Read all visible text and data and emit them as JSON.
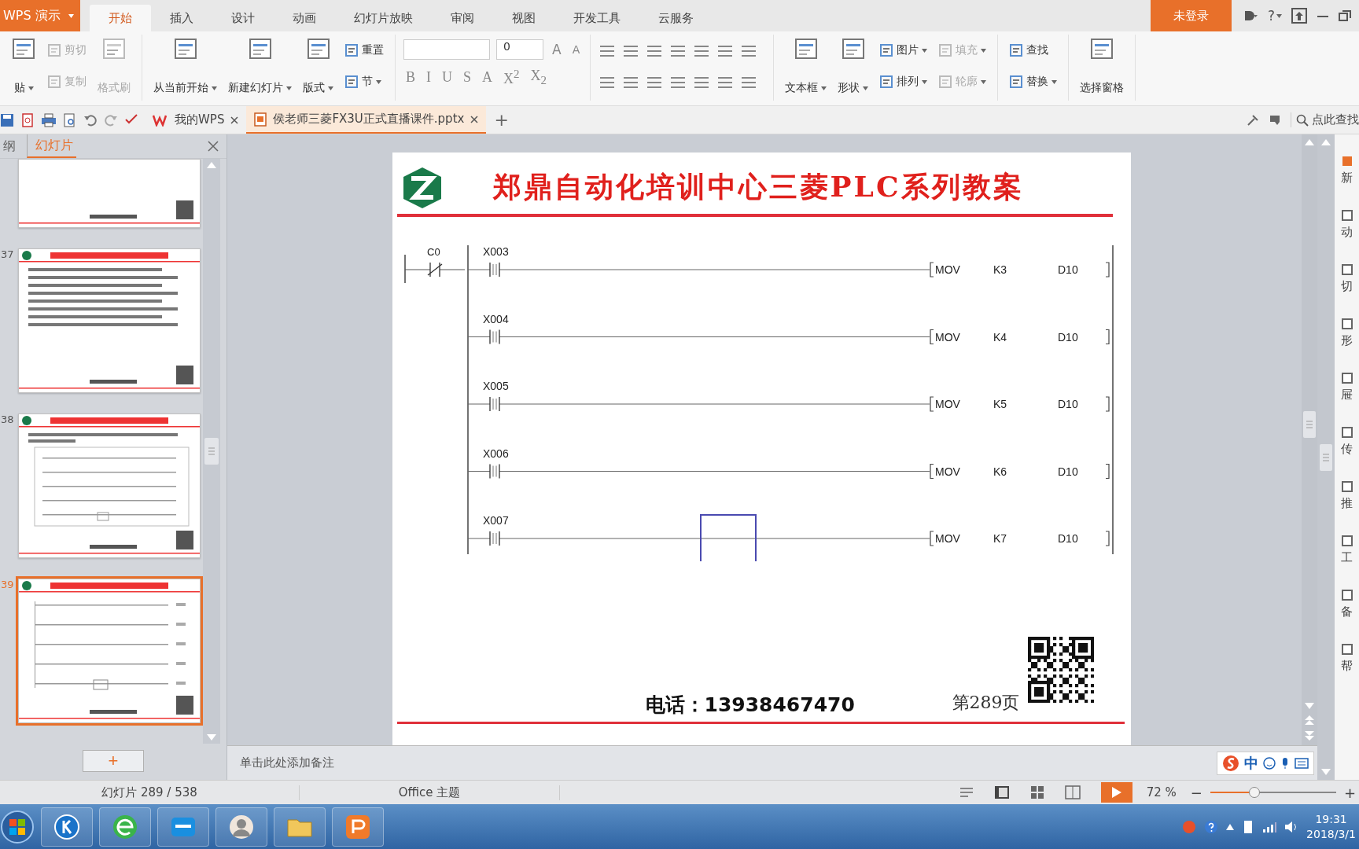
{
  "app_menu": "WPS 演示",
  "menu_tabs": [
    {
      "label": "开始",
      "selected": true
    },
    {
      "label": "插入",
      "selected": false
    },
    {
      "label": "设计",
      "selected": false
    },
    {
      "label": "动画",
      "selected": false
    },
    {
      "label": "幻灯片放映",
      "selected": false
    },
    {
      "label": "审阅",
      "selected": false
    },
    {
      "label": "视图",
      "selected": false
    },
    {
      "label": "开发工具",
      "selected": false
    },
    {
      "label": "云服务",
      "selected": false
    }
  ],
  "login_button": "未登录",
  "help_button": "?",
  "ribbon": {
    "groups": [
      {
        "kind": "buttons",
        "items": [
          {
            "label": "贴",
            "kind": "large",
            "dropdown": true,
            "disabled": false
          },
          {
            "label": "剪切",
            "kind": "small",
            "dropdown": false,
            "disabled": true
          },
          {
            "label": "复制",
            "kind": "small",
            "dropdown": false,
            "disabled": true
          },
          {
            "label": "格式刷",
            "kind": "large",
            "dropdown": false,
            "disabled": true
          }
        ]
      },
      {
        "kind": "buttons",
        "items": [
          {
            "label": "从当前开始",
            "kind": "large",
            "dropdown": true,
            "disabled": false
          },
          {
            "label": "新建幻灯片",
            "kind": "large",
            "dropdown": true,
            "disabled": false
          },
          {
            "label": "版式",
            "kind": "large",
            "dropdown": true,
            "disabled": false
          },
          {
            "label": "重置",
            "kind": "small",
            "dropdown": false,
            "disabled": false
          },
          {
            "label": "节",
            "kind": "small",
            "dropdown": true,
            "disabled": false
          }
        ]
      },
      {
        "kind": "font",
        "font_size": "0",
        "grow_font": "A",
        "shrink_font": "A",
        "format_buttons": [
          "B",
          "I",
          "U",
          "S",
          "A",
          "X$^{2}$",
          "X$_{2}$"
        ]
      },
      {
        "kind": "paragraph"
      },
      {
        "kind": "buttons",
        "items": [
          {
            "label": "文本框",
            "kind": "large",
            "dropdown": true,
            "disabled": false
          },
          {
            "label": "形状",
            "kind": "large",
            "dropdown": true,
            "disabled": false
          },
          {
            "label": "图片",
            "kind": "small",
            "dropdown": true,
            "disabled": false
          },
          {
            "label": "排列",
            "kind": "small",
            "dropdown": true,
            "disabled": false
          },
          {
            "label": "填充",
            "kind": "small",
            "dropdown": true,
            "disabled": true
          },
          {
            "label": "轮廓",
            "kind": "small",
            "dropdown": true,
            "disabled": true
          }
        ]
      },
      {
        "kind": "buttons",
        "items": [
          {
            "label": "查找",
            "kind": "small",
            "dropdown": false,
            "disabled": false
          },
          {
            "label": "替换",
            "kind": "small",
            "dropdown": true,
            "disabled": false
          }
        ]
      },
      {
        "kind": "buttons",
        "items": [
          {
            "label": "选择窗格",
            "kind": "large",
            "dropdown": false,
            "disabled": false
          }
        ]
      }
    ]
  },
  "doc_tabs": [
    {
      "label": "我的WPS",
      "selected": false
    },
    {
      "label": "侯老师三菱FX3U正式直播课件.pptx",
      "selected": true
    }
  ],
  "new_tab_button": "+",
  "command_search": "点此查找",
  "panel_tabs": [
    {
      "label": "纲",
      "selected": false
    },
    {
      "label": "幻灯片",
      "selected": true
    }
  ],
  "thumbnails": [
    {
      "kind": "footer",
      "selected": false
    },
    {
      "number": "37",
      "kind": "text",
      "selected": false
    },
    {
      "number": "38",
      "kind": "diagram",
      "selected": false
    },
    {
      "number": "39",
      "kind": "ladder",
      "selected": true
    }
  ],
  "add_slide_button": "+",
  "slide": {
    "title": "郑鼎自动化培训中心三菱PLC系列教案",
    "master_contact": {
      "label": "C0",
      "kind": "normally-closed"
    },
    "rungs": [
      {
        "contact": "X003",
        "kind": "normally-open",
        "instruction": "MOV",
        "source": "K3",
        "destination": "D10"
      },
      {
        "contact": "X004",
        "kind": "normally-open",
        "instruction": "MOV",
        "source": "K4",
        "destination": "D10"
      },
      {
        "contact": "X005",
        "kind": "normally-open",
        "instruction": "MOV",
        "source": "K5",
        "destination": "D10"
      },
      {
        "contact": "X006",
        "kind": "normally-open",
        "instruction": "MOV",
        "source": "K6",
        "destination": "D10"
      },
      {
        "contact": "X007",
        "kind": "normally-open",
        "instruction": "MOV",
        "source": "K7",
        "destination": "D10"
      }
    ],
    "phone": "电话：13938467470",
    "page": "第289页"
  },
  "notes_placeholder": "单击此处添加备注",
  "ime": "中",
  "side_tools": [
    "新",
    "动",
    "切",
    "形",
    "屉",
    "传",
    "推",
    "工",
    "备",
    "帮"
  ],
  "status": {
    "slide_counter": "幻灯片 289 / 538",
    "theme": "Office 主题",
    "zoom": "72 %",
    "zoom_out": "−",
    "zoom_in": "+",
    "zoom_level": {
      "level": 0.35
    }
  },
  "taskbar": {
    "time": "19:31",
    "date": "2018/3/1"
  }
}
